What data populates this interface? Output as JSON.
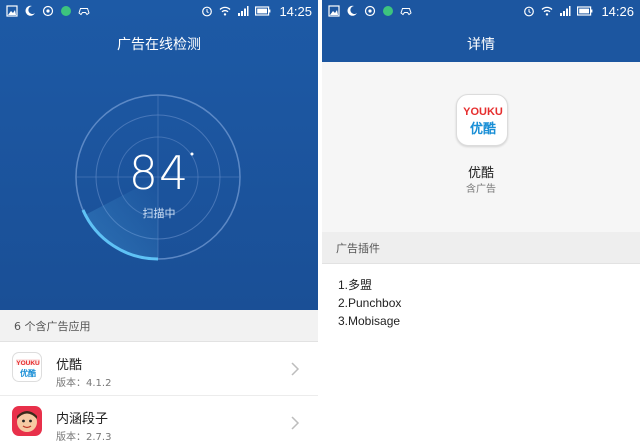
{
  "left": {
    "status": {
      "time": "14:25"
    },
    "title": "广告在线检测",
    "scan": {
      "score": "84",
      "status": "扫描中"
    },
    "section": "6 个含广告应用",
    "apps": [
      {
        "name": "优酷",
        "version": "版本：4.1.2",
        "icon": "youku-icon"
      },
      {
        "name": "内涵段子",
        "version": "版本：2.7.3",
        "icon": "neihan-icon"
      }
    ]
  },
  "right": {
    "status": {
      "time": "14:26"
    },
    "title": "详情",
    "app": {
      "name": "优酷",
      "subtitle": "含广告",
      "icon_text_top": "YOUKU",
      "icon_text_bottom": "优酷"
    },
    "section": "广告插件",
    "plugins": [
      "1.多盟",
      "2.Punchbox",
      "3.Mobisage"
    ]
  },
  "colors": {
    "primary_blue": "#1c56a0",
    "youku_red": "#e62e2e",
    "youku_blue": "#1a8fd6"
  },
  "icons": [
    "image-icon",
    "moon-icon",
    "eye-icon",
    "dot-icon",
    "gamepad-icon",
    "alarm-icon",
    "wifi-icon",
    "signal-icon",
    "battery-icon",
    "chevron-right-icon"
  ]
}
